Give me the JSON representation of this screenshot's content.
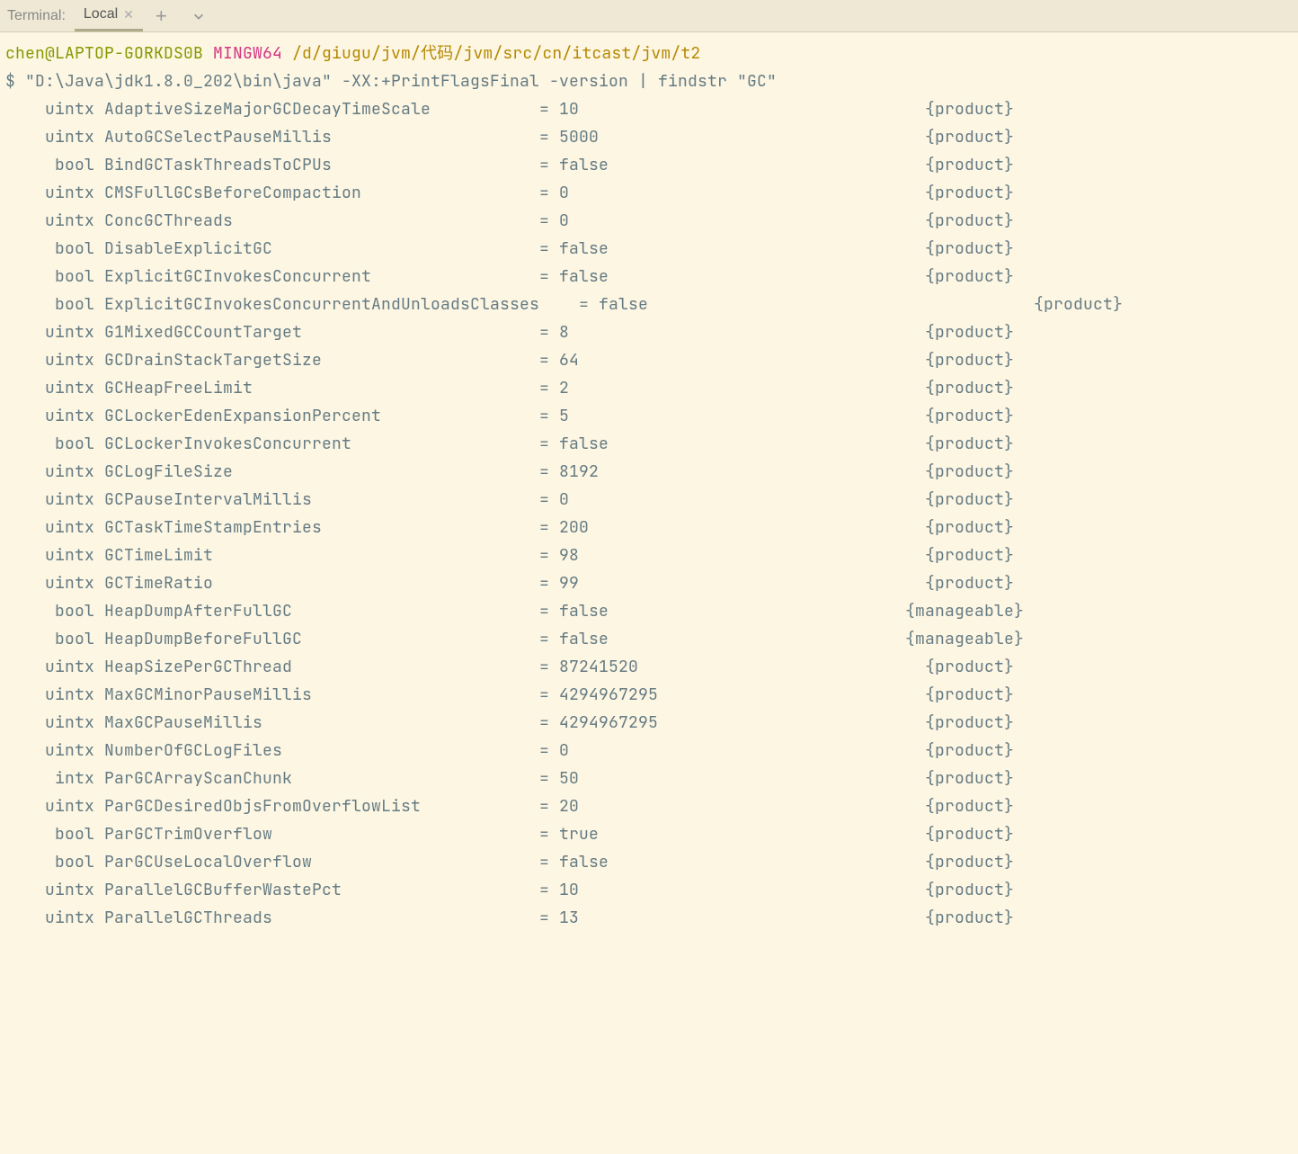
{
  "tabbar": {
    "label": "Terminal:",
    "tabs": [
      {
        "name": "Local"
      }
    ]
  },
  "prompt": {
    "user_host": "chen@LAPTOP-GORKDS0B",
    "shell": "MINGW64",
    "path": "/d/giugu/jvm/代码/jvm/src/cn/itcast/jvm/t2",
    "dollar": "$",
    "command": "\"D:\\Java\\jdk1.8.0_202\\bin\\java\" -XX:+PrintFlagsFinal -version | findstr \"GC\""
  },
  "flags": [
    {
      "type": "uintx",
      "name": "AdaptiveSizeMajorGCDecayTimeScale",
      "value": "10",
      "category": "{product}"
    },
    {
      "type": "uintx",
      "name": "AutoGCSelectPauseMillis",
      "value": "5000",
      "category": "{product}"
    },
    {
      "type": "bool",
      "name": "BindGCTaskThreadsToCPUs",
      "value": "false",
      "category": "{product}"
    },
    {
      "type": "uintx",
      "name": "CMSFullGCsBeforeCompaction",
      "value": "0",
      "category": "{product}"
    },
    {
      "type": "uintx",
      "name": "ConcGCThreads",
      "value": "0",
      "category": "{product}"
    },
    {
      "type": "bool",
      "name": "DisableExplicitGC",
      "value": "false",
      "category": "{product}"
    },
    {
      "type": "bool",
      "name": "ExplicitGCInvokesConcurrent",
      "value": "false",
      "category": "{product}"
    },
    {
      "type": "bool",
      "name": "ExplicitGCInvokesConcurrentAndUnloadsClasses",
      "value": "false",
      "category": "{product}",
      "wide": true
    },
    {
      "type": "uintx",
      "name": "G1MixedGCCountTarget",
      "value": "8",
      "category": "{product}"
    },
    {
      "type": "uintx",
      "name": "GCDrainStackTargetSize",
      "value": "64",
      "category": "{product}"
    },
    {
      "type": "uintx",
      "name": "GCHeapFreeLimit",
      "value": "2",
      "category": "{product}"
    },
    {
      "type": "uintx",
      "name": "GCLockerEdenExpansionPercent",
      "value": "5",
      "category": "{product}"
    },
    {
      "type": "bool",
      "name": "GCLockerInvokesConcurrent",
      "value": "false",
      "category": "{product}"
    },
    {
      "type": "uintx",
      "name": "GCLogFileSize",
      "value": "8192",
      "category": "{product}"
    },
    {
      "type": "uintx",
      "name": "GCPauseIntervalMillis",
      "value": "0",
      "category": "{product}"
    },
    {
      "type": "uintx",
      "name": "GCTaskTimeStampEntries",
      "value": "200",
      "category": "{product}"
    },
    {
      "type": "uintx",
      "name": "GCTimeLimit",
      "value": "98",
      "category": "{product}"
    },
    {
      "type": "uintx",
      "name": "GCTimeRatio",
      "value": "99",
      "category": "{product}"
    },
    {
      "type": "bool",
      "name": "HeapDumpAfterFullGC",
      "value": "false",
      "category": "{manageable}"
    },
    {
      "type": "bool",
      "name": "HeapDumpBeforeFullGC",
      "value": "false",
      "category": "{manageable}"
    },
    {
      "type": "uintx",
      "name": "HeapSizePerGCThread",
      "value": "87241520",
      "category": "{product}"
    },
    {
      "type": "uintx",
      "name": "MaxGCMinorPauseMillis",
      "value": "4294967295",
      "category": "{product}"
    },
    {
      "type": "uintx",
      "name": "MaxGCPauseMillis",
      "value": "4294967295",
      "category": "{product}"
    },
    {
      "type": "uintx",
      "name": "NumberOfGCLogFiles",
      "value": "0",
      "category": "{product}"
    },
    {
      "type": "intx",
      "name": "ParGCArrayScanChunk",
      "value": "50",
      "category": "{product}"
    },
    {
      "type": "uintx",
      "name": "ParGCDesiredObjsFromOverflowList",
      "value": "20",
      "category": "{product}"
    },
    {
      "type": "bool",
      "name": "ParGCTrimOverflow",
      "value": "true",
      "category": "{product}"
    },
    {
      "type": "bool",
      "name": "ParGCUseLocalOverflow",
      "value": "false",
      "category": "{product}"
    },
    {
      "type": "uintx",
      "name": "ParallelGCBufferWastePct",
      "value": "10",
      "category": "{product}"
    },
    {
      "type": "uintx",
      "name": "ParallelGCThreads",
      "value": "13",
      "category": "{product}"
    }
  ]
}
